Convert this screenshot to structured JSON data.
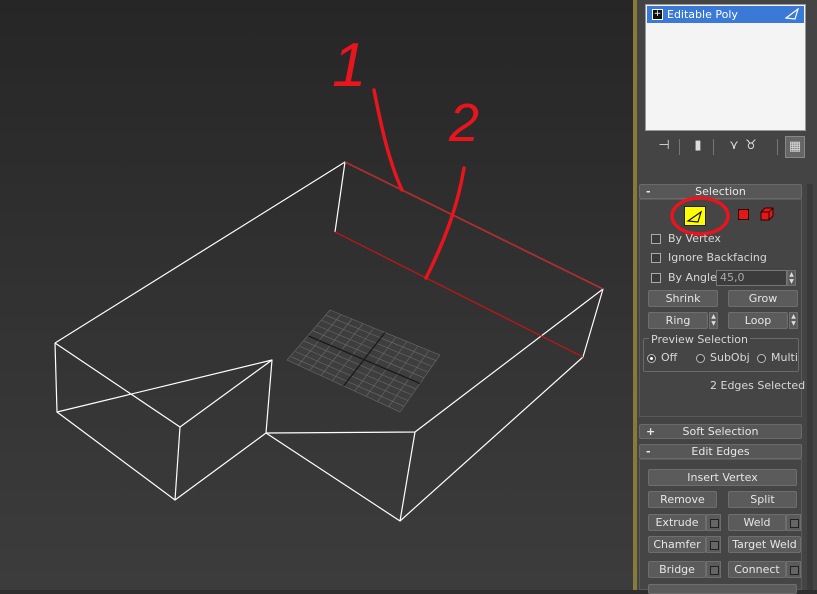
{
  "viewport": {
    "annotations": [
      "1",
      "2"
    ]
  },
  "modifier_stack": {
    "items": [
      {
        "label": "Editable Poly",
        "expand": "+"
      }
    ]
  },
  "selection": {
    "title": "Selection",
    "collapse_sign": "-",
    "subobject_modes": [
      "vertex-mode-icon",
      "edge-mode-icon",
      "polygon-mode-icon",
      "element-mode-icon"
    ],
    "by_vertex": "By Vertex",
    "ignore_backfacing": "Ignore Backfacing",
    "by_angle": "By Angle:",
    "angle_value": "45,0",
    "shrink": "Shrink",
    "grow": "Grow",
    "ring": "Ring",
    "loop": "Loop",
    "preview_title": "Preview Selection",
    "preview_options": [
      "Off",
      "SubObj",
      "Multi"
    ],
    "preview_selected": "Off",
    "status": "2 Edges Selected"
  },
  "soft_selection": {
    "title": "Soft Selection",
    "expand_sign": "+"
  },
  "edit_edges": {
    "title": "Edit Edges",
    "collapse_sign": "-",
    "insert_vertex": "Insert Vertex",
    "remove": "Remove",
    "split": "Split",
    "extrude": "Extrude",
    "weld": "Weld",
    "chamfer": "Chamfer",
    "target_weld": "Target Weld",
    "bridge": "Bridge",
    "connect": "Connect"
  },
  "colors": {
    "highlight_yellow": "#ffff00",
    "annotation_red": "#e8141e",
    "selected_edge": "#c81414",
    "wire_white": "#ffffff",
    "stack_selected": "#3a79d6"
  }
}
